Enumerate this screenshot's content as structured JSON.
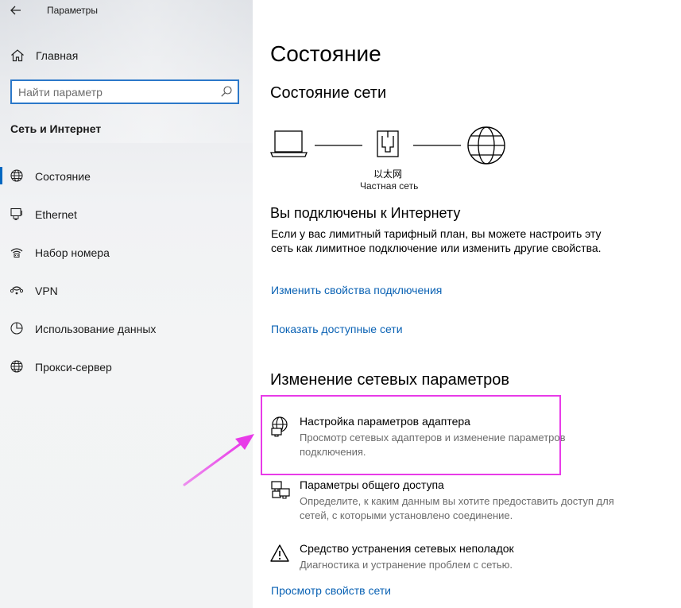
{
  "window": {
    "title": "Параметры"
  },
  "sidebar": {
    "home_label": "Главная",
    "search_placeholder": "Найти параметр",
    "section_title": "Сеть и Интернет",
    "items": [
      {
        "label": "Состояние",
        "icon": "globe-icon",
        "selected": true
      },
      {
        "label": "Ethernet",
        "icon": "ethernet-icon",
        "selected": false
      },
      {
        "label": "Набор номера",
        "icon": "dialup-icon",
        "selected": false
      },
      {
        "label": "VPN",
        "icon": "vpn-icon",
        "selected": false
      },
      {
        "label": "Использование данных",
        "icon": "data-usage-icon",
        "selected": false
      },
      {
        "label": "Прокси-сервер",
        "icon": "globe-icon",
        "selected": false
      }
    ]
  },
  "main": {
    "title": "Состояние",
    "network_status_heading": "Состояние сети",
    "network": {
      "name": "以太网",
      "type": "Частная сеть"
    },
    "connected_heading": "Вы подключены к Интернету",
    "connected_text": "Если у вас лимитный тарифный план, вы можете настроить эту сеть как лимитное подключение или изменить другие свойства.",
    "links": {
      "change_props": "Изменить свойства подключения",
      "show_networks": "Показать доступные сети",
      "view_props": "Просмотр свойств сети"
    },
    "change_heading": "Изменение сетевых параметров",
    "actions": [
      {
        "title": "Настройка параметров адаптера",
        "desc": "Просмотр сетевых адаптеров и изменение параметров подключения.",
        "icon": "adapter-icon"
      },
      {
        "title": "Параметры общего доступа",
        "desc": "Определите, к каким данным вы хотите предоставить доступ для сетей, с которыми установлено соединение.",
        "icon": "sharing-icon"
      },
      {
        "title": "Средство устранения сетевых неполадок",
        "desc": "Диагностика и устранение проблем с сетью.",
        "icon": "warning-icon"
      }
    ]
  },
  "colors": {
    "accent": "#0067c0",
    "link": "#0a62b4",
    "highlight": "#e83be8"
  }
}
